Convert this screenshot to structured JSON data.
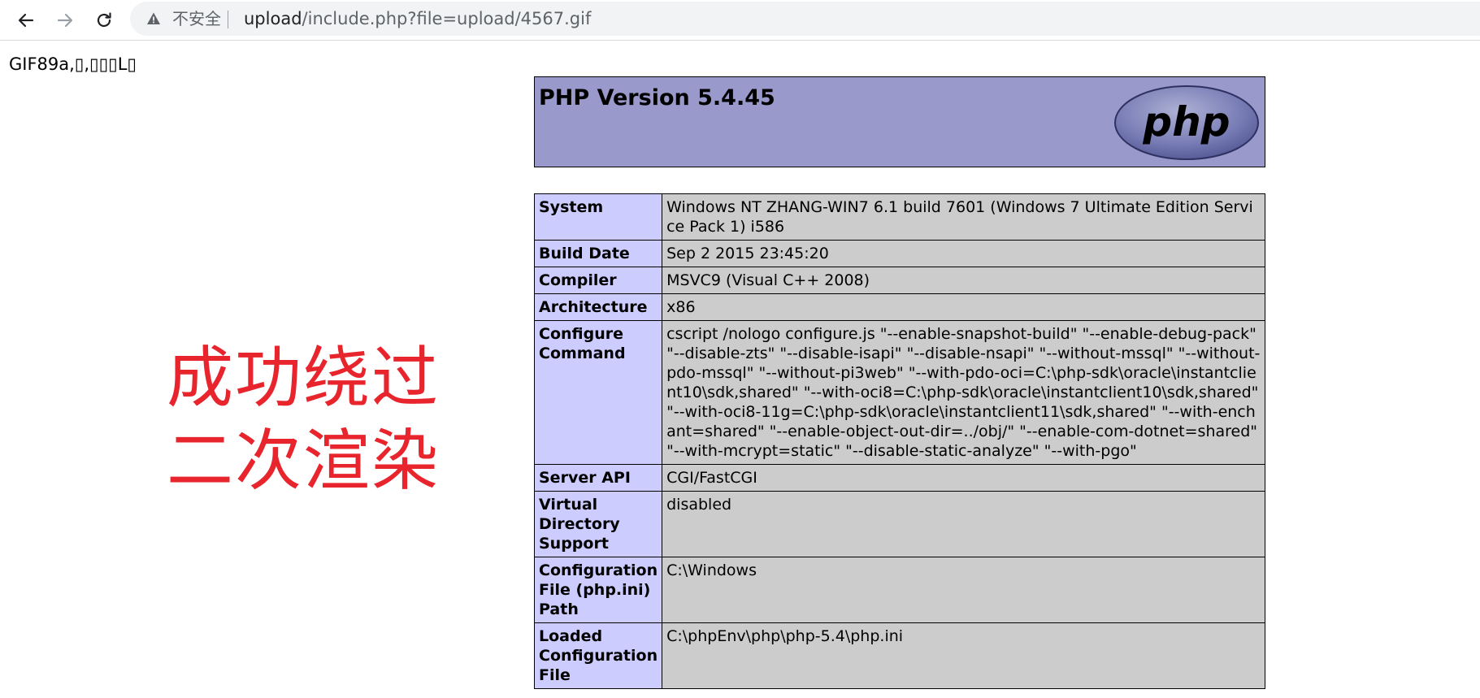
{
  "browser": {
    "nav": {
      "back_icon": "arrow-left-icon",
      "forward_icon": "arrow-right-icon",
      "reload_icon": "reload-icon"
    },
    "address_bar": {
      "security_icon": "warning-triangle-icon",
      "security_label": "不安全",
      "url_host": "upload",
      "url_path": "/include.php?file=upload/4567.gif"
    }
  },
  "page": {
    "gif_header": "GIF89a,▯,▯▯▯L▯",
    "overlay_line1": "成功绕过",
    "overlay_line2": "二次渲染",
    "overlay_color": "#e8242c",
    "php_version_title": "PHP Version 5.4.45",
    "php_logo_text": "php",
    "info_rows": [
      {
        "label": "System",
        "value": "Windows NT ZHANG-WIN7 6.1 build 7601 (Windows 7 Ultimate Edition Service Pack 1) i586"
      },
      {
        "label": "Build Date",
        "value": "Sep 2 2015 23:45:20"
      },
      {
        "label": "Compiler",
        "value": "MSVC9 (Visual C++ 2008)"
      },
      {
        "label": "Architecture",
        "value": "x86"
      },
      {
        "label": "Configure Command",
        "value": "cscript /nologo configure.js \"--enable-snapshot-build\" \"--enable-debug-pack\" \"--disable-zts\" \"--disable-isapi\" \"--disable-nsapi\" \"--without-mssql\" \"--without-pdo-mssql\" \"--without-pi3web\" \"--with-pdo-oci=C:\\php-sdk\\oracle\\instantclient10\\sdk,shared\" \"--with-oci8=C:\\php-sdk\\oracle\\instantclient10\\sdk,shared\" \"--with-oci8-11g=C:\\php-sdk\\oracle\\instantclient11\\sdk,shared\" \"--with-enchant=shared\" \"--enable-object-out-dir=../obj/\" \"--enable-com-dotnet=shared\" \"--with-mcrypt=static\" \"--disable-static-analyze\" \"--with-pgo\""
      },
      {
        "label": "Server API",
        "value": "CGI/FastCGI"
      },
      {
        "label": "Virtual Directory Support",
        "value": "disabled"
      },
      {
        "label": "Configuration File (php.ini) Path",
        "value": "C:\\Windows"
      },
      {
        "label": "Loaded Configuration File",
        "value": "C:\\phpEnv\\php\\php-5.4\\php.ini"
      }
    ],
    "colors": {
      "header_bg": "#9999cc",
      "label_bg": "#ccccff",
      "value_bg": "#cccccc"
    }
  }
}
